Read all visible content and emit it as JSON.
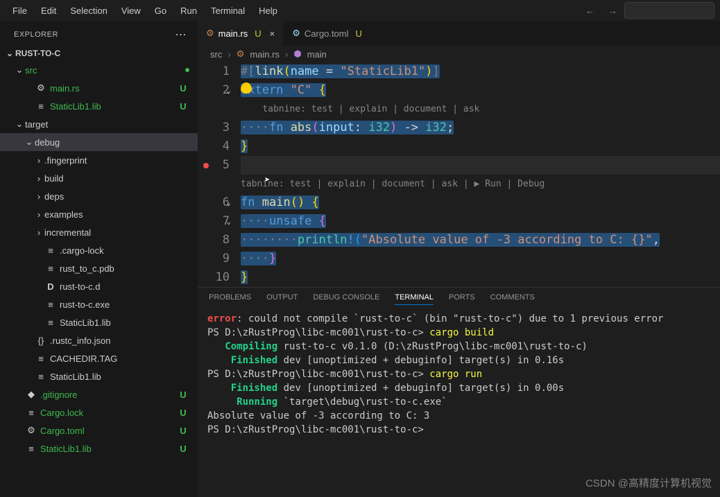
{
  "menubar": [
    "File",
    "Edit",
    "Selection",
    "View",
    "Go",
    "Run",
    "Terminal",
    "Help"
  ],
  "nav": {
    "back": "←",
    "forward": "→"
  },
  "explorer": {
    "title": "EXPLORER",
    "project": "RUST-TO-C",
    "tree": [
      {
        "depth": 1,
        "chev": "⌄",
        "icon": "",
        "iconClass": "",
        "label": "src",
        "badge": "●",
        "badgeClass": "dot-green",
        "labelClass": "c-untracked"
      },
      {
        "depth": 2,
        "chev": "",
        "icon": "⚙",
        "iconClass": "i-rust",
        "label": "main.rs",
        "badge": "U",
        "badgeClass": "c-untracked",
        "labelClass": "c-untracked"
      },
      {
        "depth": 2,
        "chev": "",
        "icon": "≡",
        "iconClass": "i-file",
        "label": "StaticLib1.lib",
        "badge": "U",
        "badgeClass": "c-untracked",
        "labelClass": "c-untracked"
      },
      {
        "depth": 1,
        "chev": "⌄",
        "icon": "",
        "iconClass": "",
        "label": "target",
        "badge": "",
        "badgeClass": "",
        "labelClass": ""
      },
      {
        "depth": 2,
        "chev": "⌄",
        "icon": "",
        "iconClass": "",
        "label": "debug",
        "badge": "",
        "badgeClass": "",
        "labelClass": "",
        "selected": true
      },
      {
        "depth": 3,
        "chev": "›",
        "icon": "",
        "iconClass": "",
        "label": ".fingerprint",
        "badge": "",
        "badgeClass": "",
        "labelClass": ""
      },
      {
        "depth": 3,
        "chev": "›",
        "icon": "",
        "iconClass": "",
        "label": "build",
        "badge": "",
        "badgeClass": "",
        "labelClass": ""
      },
      {
        "depth": 3,
        "chev": "›",
        "icon": "",
        "iconClass": "",
        "label": "deps",
        "badge": "",
        "badgeClass": "",
        "labelClass": ""
      },
      {
        "depth": 3,
        "chev": "›",
        "icon": "",
        "iconClass": "",
        "label": "examples",
        "badge": "",
        "badgeClass": "",
        "labelClass": ""
      },
      {
        "depth": 3,
        "chev": "›",
        "icon": "",
        "iconClass": "",
        "label": "incremental",
        "badge": "",
        "badgeClass": "",
        "labelClass": ""
      },
      {
        "depth": 3,
        "chev": "",
        "icon": "≡",
        "iconClass": "i-file",
        "label": ".cargo-lock",
        "badge": "",
        "badgeClass": "",
        "labelClass": ""
      },
      {
        "depth": 3,
        "chev": "",
        "icon": "≡",
        "iconClass": "i-file",
        "label": "rust_to_c.pdb",
        "badge": "",
        "badgeClass": "",
        "labelClass": ""
      },
      {
        "depth": 3,
        "chev": "",
        "icon": "D",
        "iconClass": "i-d-red",
        "label": "rust-to-c.d",
        "badge": "",
        "badgeClass": "",
        "labelClass": ""
      },
      {
        "depth": 3,
        "chev": "",
        "icon": "≡",
        "iconClass": "i-file",
        "label": "rust-to-c.exe",
        "badge": "",
        "badgeClass": "",
        "labelClass": ""
      },
      {
        "depth": 3,
        "chev": "",
        "icon": "≡",
        "iconClass": "i-file",
        "label": "StaticLib1.lib",
        "badge": "",
        "badgeClass": "",
        "labelClass": ""
      },
      {
        "depth": 2,
        "chev": "",
        "icon": "{}",
        "iconClass": "i-json-y",
        "label": ".rustc_info.json",
        "badge": "",
        "badgeClass": "",
        "labelClass": ""
      },
      {
        "depth": 2,
        "chev": "",
        "icon": "≡",
        "iconClass": "i-file",
        "label": "CACHEDIR.TAG",
        "badge": "",
        "badgeClass": "",
        "labelClass": ""
      },
      {
        "depth": 2,
        "chev": "",
        "icon": "≡",
        "iconClass": "i-file",
        "label": "StaticLib1.lib",
        "badge": "",
        "badgeClass": "",
        "labelClass": ""
      },
      {
        "depth": 1,
        "chev": "",
        "icon": "◆",
        "iconClass": "i-git",
        "label": ".gitignore",
        "badge": "U",
        "badgeClass": "c-untracked",
        "labelClass": "c-untracked"
      },
      {
        "depth": 1,
        "chev": "",
        "icon": "≡",
        "iconClass": "i-file",
        "label": "Cargo.lock",
        "badge": "U",
        "badgeClass": "c-untracked",
        "labelClass": "c-untracked"
      },
      {
        "depth": 1,
        "chev": "",
        "icon": "⚙",
        "iconClass": "i-toml",
        "label": "Cargo.toml",
        "badge": "U",
        "badgeClass": "c-untracked",
        "labelClass": "c-untracked"
      },
      {
        "depth": 1,
        "chev": "",
        "icon": "≡",
        "iconClass": "i-file",
        "label": "StaticLib1.lib",
        "badge": "U",
        "badgeClass": "c-untracked",
        "labelClass": "c-untracked"
      }
    ]
  },
  "tabs": [
    {
      "icon": "⚙",
      "iconClass": "i-rust",
      "label": "main.rs",
      "mod": "U",
      "active": true,
      "close": true
    },
    {
      "icon": "⚙",
      "iconClass": "i-toml",
      "label": "Cargo.toml",
      "mod": "U",
      "active": false,
      "close": false
    }
  ],
  "breadcrumb": {
    "parts": [
      "src",
      "main.rs",
      "main"
    ]
  },
  "codelens1": "tabnine: test | explain | document | ask",
  "codelens2": "tabnine: test | explain | document | ask | ▶ Run | Debug",
  "panel": {
    "tabs": [
      "PROBLEMS",
      "OUTPUT",
      "DEBUG CONSOLE",
      "TERMINAL",
      "PORTS",
      "COMMENTS"
    ],
    "active": 3
  },
  "terminal": {
    "l1a": "error",
    "l1b": ": could not compile `rust-to-c` (bin \"rust-to-c\") due to 1 previous error",
    "l2a": "PS D:\\zRustProg\\libc-mc001\\rust-to-c> ",
    "l2b": "cargo build",
    "l3a": "   Compiling",
    "l3b": " rust-to-c v0.1.0 (D:\\zRustProg\\libc-mc001\\rust-to-c)",
    "l4a": "    Finished",
    "l4b": " dev [unoptimized + debuginfo] target(s) in 0.16s",
    "l5a": "PS D:\\zRustProg\\libc-mc001\\rust-to-c> ",
    "l5b": "cargo run",
    "l6a": "    Finished",
    "l6b": " dev [unoptimized + debuginfo] target(s) in 0.00s",
    "l7a": "     Running",
    "l7b": " `target\\debug\\rust-to-c.exe`",
    "l8": "Absolute value of -3 according to C: 3",
    "l9": "PS D:\\zRustProg\\libc-mc001\\rust-to-c> "
  },
  "watermark": "CSDN @高精度计算机视觉"
}
